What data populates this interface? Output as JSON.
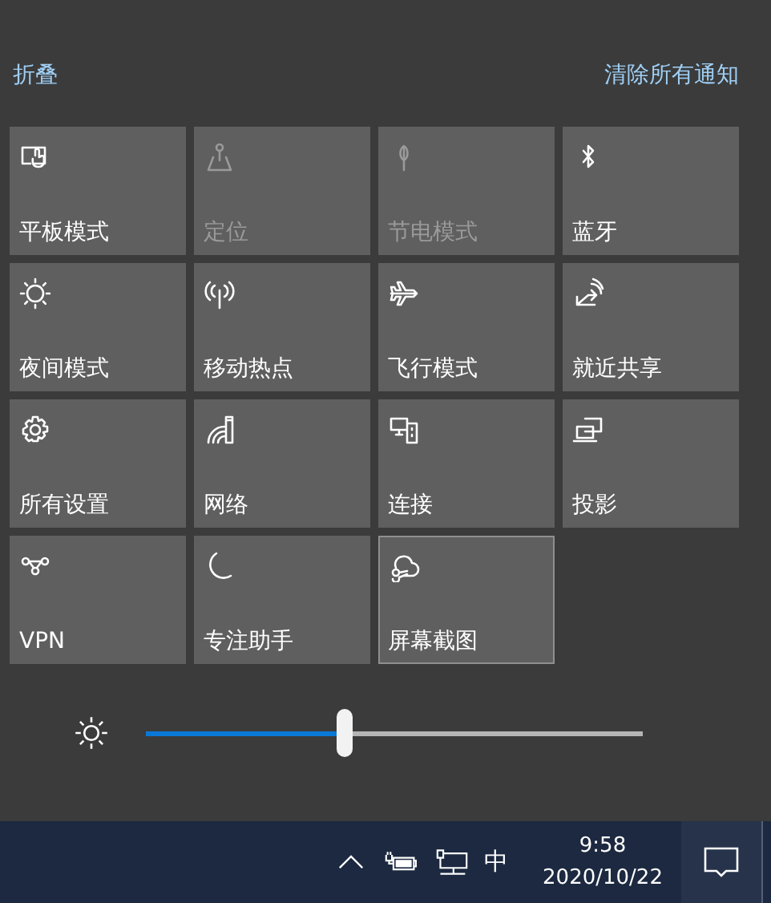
{
  "header": {
    "collapse_link": "折叠",
    "clear_link": "清除所有通知"
  },
  "tiles": [
    {
      "label": "平板模式",
      "disabled": false,
      "focused": false
    },
    {
      "label": "定位",
      "disabled": true,
      "focused": false
    },
    {
      "label": "节电模式",
      "disabled": true,
      "focused": false
    },
    {
      "label": "蓝牙",
      "disabled": false,
      "focused": false
    },
    {
      "label": "夜间模式",
      "disabled": false,
      "focused": false
    },
    {
      "label": "移动热点",
      "disabled": false,
      "focused": false
    },
    {
      "label": "飞行模式",
      "disabled": false,
      "focused": false
    },
    {
      "label": "就近共享",
      "disabled": false,
      "focused": false
    },
    {
      "label": "所有设置",
      "disabled": false,
      "focused": false
    },
    {
      "label": "网络",
      "disabled": false,
      "focused": false
    },
    {
      "label": "连接",
      "disabled": false,
      "focused": false
    },
    {
      "label": "投影",
      "disabled": false,
      "focused": false
    },
    {
      "label": "VPN",
      "disabled": false,
      "focused": false
    },
    {
      "label": "专注助手",
      "disabled": false,
      "focused": false
    },
    {
      "label": "屏幕截图",
      "disabled": false,
      "focused": true
    }
  ],
  "brightness": {
    "level": 0.4
  },
  "taskbar": {
    "ime": "中",
    "time": "9:58",
    "date": "2020/10/22"
  }
}
